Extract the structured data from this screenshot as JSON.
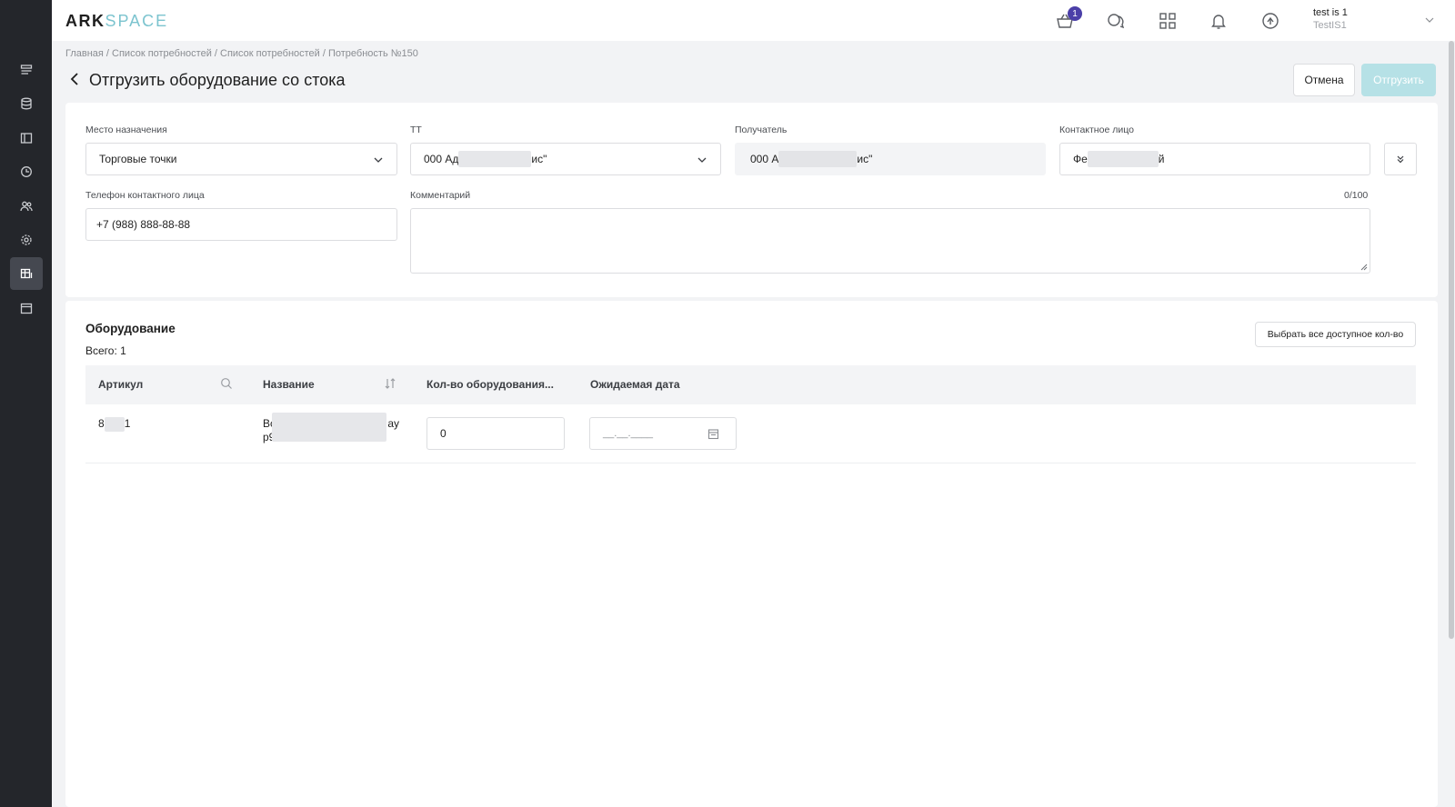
{
  "app": {
    "logo_part1": "ARK",
    "logo_part2": "SPACE",
    "cart_count": "1"
  },
  "user": {
    "name": "test is 1",
    "sub": "TestIS1"
  },
  "breadcrumb": "Главная / Список потребностей / Список потребностей / Потребность №150",
  "page": {
    "title": "Отгрузить оборудование со стока",
    "cancel_label": "Отмена",
    "ship_label": "Отгрузить"
  },
  "form": {
    "destination": {
      "label": "Место назначения",
      "value": "Торговые точки"
    },
    "tt": {
      "label": "ТТ",
      "value_start": "000 Ад",
      "value_end": "ис\""
    },
    "recipient": {
      "label": "Получатель",
      "value_start": "000 А",
      "value_end": "ис\""
    },
    "contact": {
      "label": "Контактное лицо",
      "value_start": "Фе",
      "value_end": "й"
    },
    "phone": {
      "label": "Телефон контактного лица",
      "value": "+7 (988) 888-88-88"
    },
    "comment": {
      "label": "Комментарий",
      "counter": "0/100",
      "value": ""
    }
  },
  "equipment": {
    "title": "Оборудование",
    "total": "Всего: 1",
    "select_all_label": "Выбрать все доступное кол-во",
    "columns": {
      "article": "Артикул",
      "name": "Название",
      "qty": "Кол-во оборудования...",
      "date": "Ожидаемая дата"
    },
    "rows": [
      {
        "article_start": "8",
        "article_end": "1",
        "name_line1_start": "Вс",
        "name_line1_end": "ay",
        "name_line2": "p9",
        "qty": "0",
        "date_placeholder": "__.__.____"
      }
    ]
  }
}
